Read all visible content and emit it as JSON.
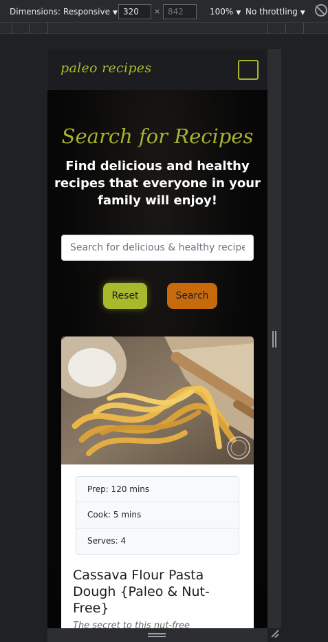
{
  "devtools": {
    "dimensions_label": "Dimensions: Responsive",
    "width_value": "320",
    "height_placeholder": "842",
    "times": "×",
    "zoom_label": "100%",
    "throttle_label": "No throttling",
    "caret": "▼"
  },
  "site": {
    "brand": "paleo recipes",
    "hero": {
      "title": "Search for Recipes",
      "subtitle": "Find delicious and healthy recipes that everyone in your family will enjoy!"
    },
    "search": {
      "placeholder": "Search for delicious & healthy recipes",
      "reset_label": "Reset",
      "search_label": "Search"
    },
    "recipe": {
      "prep": "Prep: 120 mins",
      "cook": "Cook: 5 mins",
      "serves": "Serves: 4",
      "title": "Cassava Flour Pasta Dough {Paleo & Nut-Free}",
      "description": "The secret to this nut-free"
    }
  },
  "colors": {
    "accent_green": "#a8b92b",
    "accent_orange": "#c76a0c",
    "navbar_bg": "#1b1d21"
  },
  "icons": [
    "hamburger-menu-icon",
    "rotate-disabled-icon",
    "resize-grip-icon"
  ]
}
